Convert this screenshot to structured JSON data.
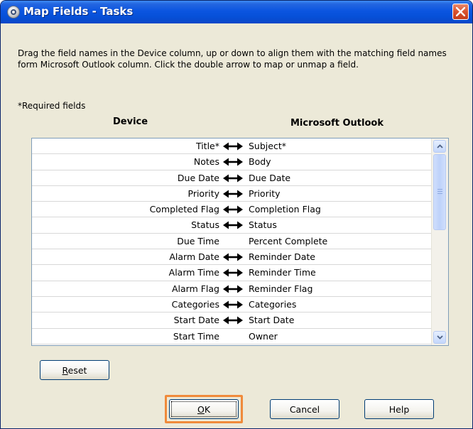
{
  "window": {
    "title": "Map Fields - Tasks"
  },
  "instructions": "Drag the field names in the Device column, up or down to align them with the matching field names form Microsoft Outlook column. Click the double arrow to map or unmap a field.",
  "required_note": "*Required fields",
  "columns": {
    "device": "Device",
    "outlook": "Microsoft Outlook"
  },
  "rows": [
    {
      "device": "Title*",
      "outlook": "Subject*",
      "mapped": true
    },
    {
      "device": "Notes",
      "outlook": "Body",
      "mapped": true
    },
    {
      "device": "Due Date",
      "outlook": "Due Date",
      "mapped": true
    },
    {
      "device": "Priority",
      "outlook": "Priority",
      "mapped": true
    },
    {
      "device": "Completed Flag",
      "outlook": "Completion Flag",
      "mapped": true
    },
    {
      "device": "Status",
      "outlook": "Status",
      "mapped": true
    },
    {
      "device": "Due Time",
      "outlook": "Percent Complete",
      "mapped": false
    },
    {
      "device": "Alarm Date",
      "outlook": "Reminder Date",
      "mapped": true
    },
    {
      "device": "Alarm Time",
      "outlook": "Reminder Time",
      "mapped": true
    },
    {
      "device": "Alarm Flag",
      "outlook": "Reminder Flag",
      "mapped": true
    },
    {
      "device": "Categories",
      "outlook": "Categories",
      "mapped": true
    },
    {
      "device": "Start Date",
      "outlook": "Start Date",
      "mapped": true
    },
    {
      "device": "Start Time",
      "outlook": "Owner",
      "mapped": false
    }
  ],
  "buttons": {
    "reset_label": "Reset",
    "reset_mnemonic": "R",
    "reset_rest": "eset",
    "ok_label": "OK",
    "ok_mnemonic": "O",
    "ok_rest": "K",
    "cancel_label": "Cancel",
    "help_label": "Help"
  },
  "icons": {
    "title": "app-icon",
    "close": "close-icon",
    "map_arrow": "double-arrow-icon",
    "scroll_up": "chevron-up-icon",
    "scroll_down": "chevron-down-icon"
  },
  "colors": {
    "titlebar": "#0b55e0",
    "close_button": "#d9522d",
    "dialog_background": "#ece9d8",
    "ok_highlight": "#f08a3a"
  }
}
